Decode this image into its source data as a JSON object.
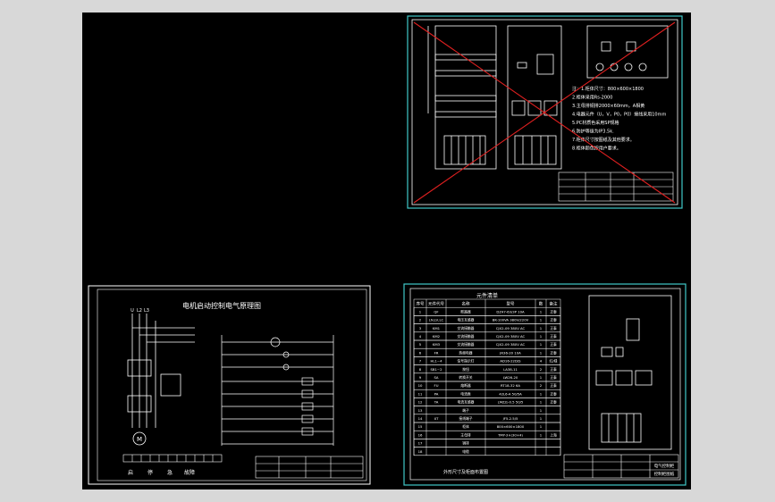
{
  "sheet_cabinet": {
    "notes": [
      "注：1.柜体尺寸：800×600×1800",
      "2.柜体采用Rs-2000",
      "3.主母排铜排2000×60mm，A相黄",
      "4.电器元件（U，V，P0，P0）接线采用10mm",
      "5.PC材质色采用SP规格",
      "6.防护等级为IP3.5k.",
      "7.柜体尺寸按图纸及其他要求。",
      "8.柜体颜色按用户要求。"
    ]
  },
  "sheet_schematic": {
    "title": "电机启动控制电气原理图",
    "phase_labels": [
      "U",
      "L2",
      "L3"
    ],
    "motor_label": "M",
    "bottom_labels": [
      "启",
      "停",
      "急",
      "故障"
    ]
  },
  "sheet_parts": {
    "table_title": "元件清单",
    "headers": [
      "序号",
      "元件代号",
      "名称",
      "型号",
      "数",
      "备注"
    ],
    "rows": [
      [
        "1",
        "QF",
        "断路器",
        "DZ47-63/3P 10A",
        "1",
        "正泰"
      ],
      [
        "2",
        "LN,LV,LC",
        "电压互感器",
        "BK-100VA 380V/220V",
        "1",
        "正泰"
      ],
      [
        "3",
        "KM1",
        "交流接触器",
        "CJX2-09 380V AC",
        "1",
        "正泰"
      ],
      [
        "4",
        "KM2",
        "交流接触器",
        "CJX2-09 380V AC",
        "1",
        "正泰"
      ],
      [
        "5",
        "KM3",
        "交流接触器",
        "CJX2-09 380V AC",
        "1",
        "正泰"
      ],
      [
        "6",
        "FR",
        "热继电器",
        "JR36-20 10A",
        "1",
        "正泰"
      ],
      [
        "7",
        "HL1~4",
        "信号指示灯",
        "AD16-22D/S",
        "4",
        "红/绿"
      ],
      [
        "8",
        "SB1~2",
        "按钮",
        "LA38-11",
        "2",
        "正泰"
      ],
      [
        "9",
        "SA",
        "转换开关",
        "LW26-20",
        "1",
        "正泰"
      ],
      [
        "10",
        "FU",
        "熔断器",
        "RT18-32 6A",
        "2",
        "正泰"
      ],
      [
        "11",
        "PA",
        "电流表",
        "42L6-A 50/5A",
        "1",
        "正泰"
      ],
      [
        "12",
        "TA",
        "电流互感器",
        "LMZJ1-0.5 50/5",
        "1",
        "正泰"
      ],
      [
        "13",
        "",
        "端子",
        "",
        "1",
        ""
      ],
      [
        "14",
        "XT",
        "接线端子",
        "JF5-2.5/5",
        "1",
        ""
      ],
      [
        "15",
        "",
        "柜体",
        "800×600×1800",
        "1",
        ""
      ],
      [
        "16",
        "",
        "主母排",
        "TMY-3×(30×4)",
        "1",
        "上海"
      ],
      [
        "17",
        "",
        "铜排",
        "",
        "",
        ""
      ],
      [
        "18",
        "",
        "电缆",
        "",
        "",
        ""
      ]
    ],
    "footer": "外形尺寸及柜面布置图"
  },
  "title_block": {
    "company": "电气控制柜",
    "drawing": "控制柜图纸"
  },
  "colors": {
    "background": "#000000",
    "outer_frame": "#d8d8d8",
    "sheet_border": "#ffffff",
    "cabinet_border": "#40c8c8",
    "cancel_cross": "#e02020"
  }
}
